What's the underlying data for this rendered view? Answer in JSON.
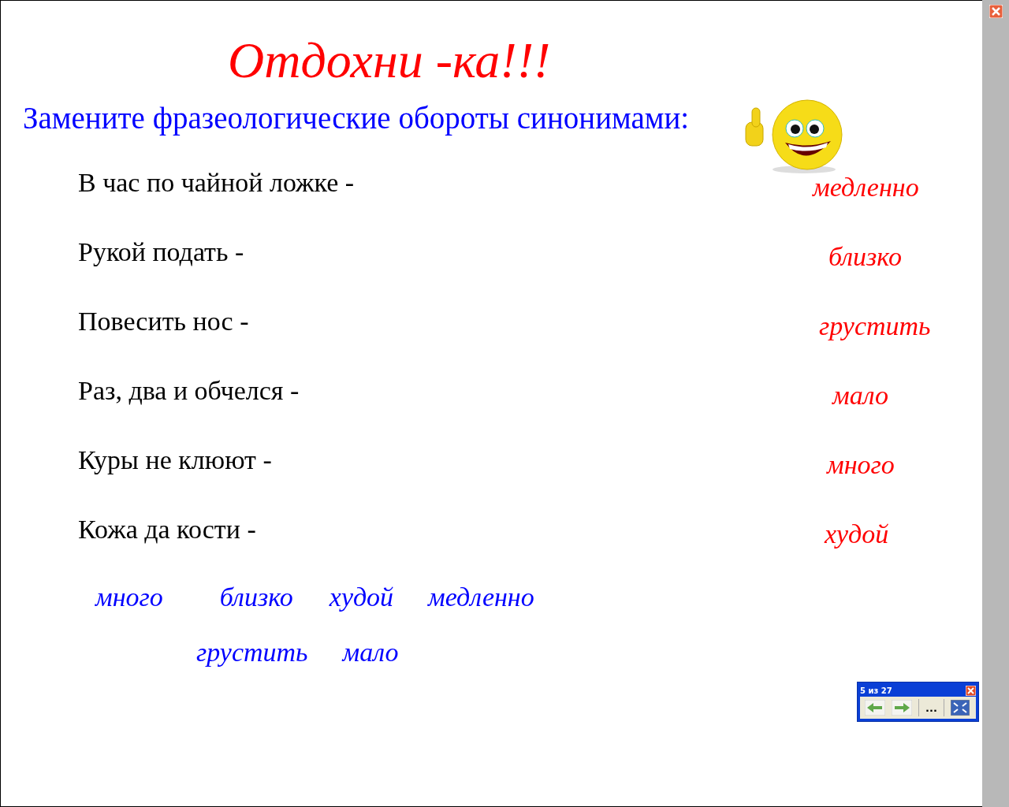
{
  "slide": {
    "title": "Отдохни -ка!!!",
    "instruction": "Замените фразеологические обороты синонимами:",
    "rows": [
      {
        "phrase": "В час по чайной ложке -",
        "answer": "медленно"
      },
      {
        "phrase": "Рукой подать -",
        "answer": "близко"
      },
      {
        "phrase": "Повесить нос -",
        "answer": "грустить"
      },
      {
        "phrase": "Раз, два и обчелся -",
        "answer": "мало"
      },
      {
        "phrase": "Куры не клюют -",
        "answer": "много"
      },
      {
        "phrase": "Кожа да кости -",
        "answer": "худой"
      }
    ],
    "word_bank": [
      [
        "много",
        "близко",
        "худой",
        "медленно"
      ],
      [
        "грустить",
        "мало"
      ]
    ]
  },
  "navigator": {
    "counter": "5 из 27",
    "menu": "..."
  }
}
